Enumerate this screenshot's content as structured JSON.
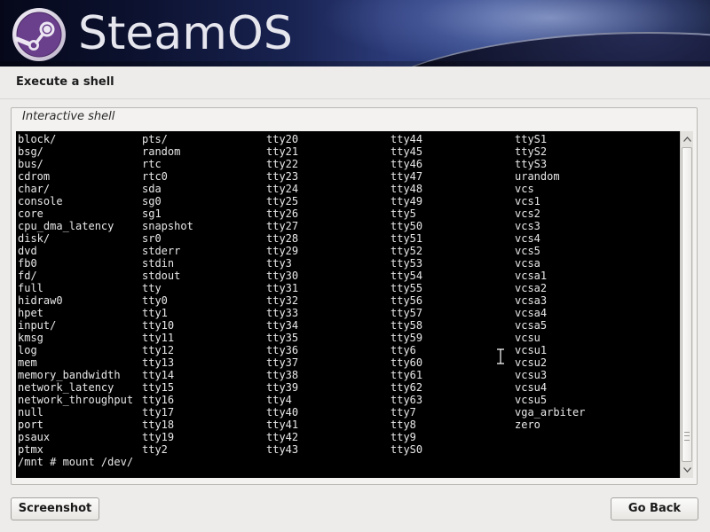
{
  "header": {
    "brand": "SteamOS",
    "logo_icon": "steam-logo-icon"
  },
  "step_title": "Execute a shell",
  "shell_frame": {
    "label": "Interactive shell"
  },
  "terminal": {
    "columns": [
      [
        "block/",
        "bsg/",
        "bus/",
        "cdrom",
        "char/",
        "console",
        "core",
        "cpu_dma_latency",
        "disk/",
        "dvd",
        "fb0",
        "fd/",
        "full",
        "hidraw0",
        "hpet",
        "input/",
        "kmsg",
        "log",
        "mem",
        "memory_bandwidth",
        "network_latency",
        "network_throughput",
        "null",
        "port",
        "psaux",
        "ptmx"
      ],
      [
        "pts/",
        "random",
        "rtc",
        "rtc0",
        "sda",
        "sg0",
        "sg1",
        "snapshot",
        "sr0",
        "stderr",
        "stdin",
        "stdout",
        "tty",
        "tty0",
        "tty1",
        "tty10",
        "tty11",
        "tty12",
        "tty13",
        "tty14",
        "tty15",
        "tty16",
        "tty17",
        "tty18",
        "tty19",
        "tty2"
      ],
      [
        "tty20",
        "tty21",
        "tty22",
        "tty23",
        "tty24",
        "tty25",
        "tty26",
        "tty27",
        "tty28",
        "tty29",
        "tty3",
        "tty30",
        "tty31",
        "tty32",
        "tty33",
        "tty34",
        "tty35",
        "tty36",
        "tty37",
        "tty38",
        "tty39",
        "tty4",
        "tty40",
        "tty41",
        "tty42",
        "tty43"
      ],
      [
        "tty44",
        "tty45",
        "tty46",
        "tty47",
        "tty48",
        "tty49",
        "tty5",
        "tty50",
        "tty51",
        "tty52",
        "tty53",
        "tty54",
        "tty55",
        "tty56",
        "tty57",
        "tty58",
        "tty59",
        "tty6",
        "tty60",
        "tty61",
        "tty62",
        "tty63",
        "tty7",
        "tty8",
        "tty9",
        "ttyS0"
      ],
      [
        "ttyS1",
        "ttyS2",
        "ttyS3",
        "urandom",
        "vcs",
        "vcs1",
        "vcs2",
        "vcs3",
        "vcs4",
        "vcs5",
        "vcsa",
        "vcsa1",
        "vcsa2",
        "vcsa3",
        "vcsa4",
        "vcsa5",
        "vcsu",
        "vcsu1",
        "vcsu2",
        "vcsu3",
        "vcsu4",
        "vcsu5",
        "vga_arbiter",
        "zero",
        "",
        ""
      ]
    ],
    "prompt": "/mnt # mount /dev/",
    "scroll_position": 1.0
  },
  "buttons": {
    "screenshot": "Screenshot",
    "go_back": "Go Back"
  },
  "colors": {
    "terminal_bg": "#000000",
    "terminal_fg": "#e8e8e8",
    "window_bg": "#edeceb"
  }
}
